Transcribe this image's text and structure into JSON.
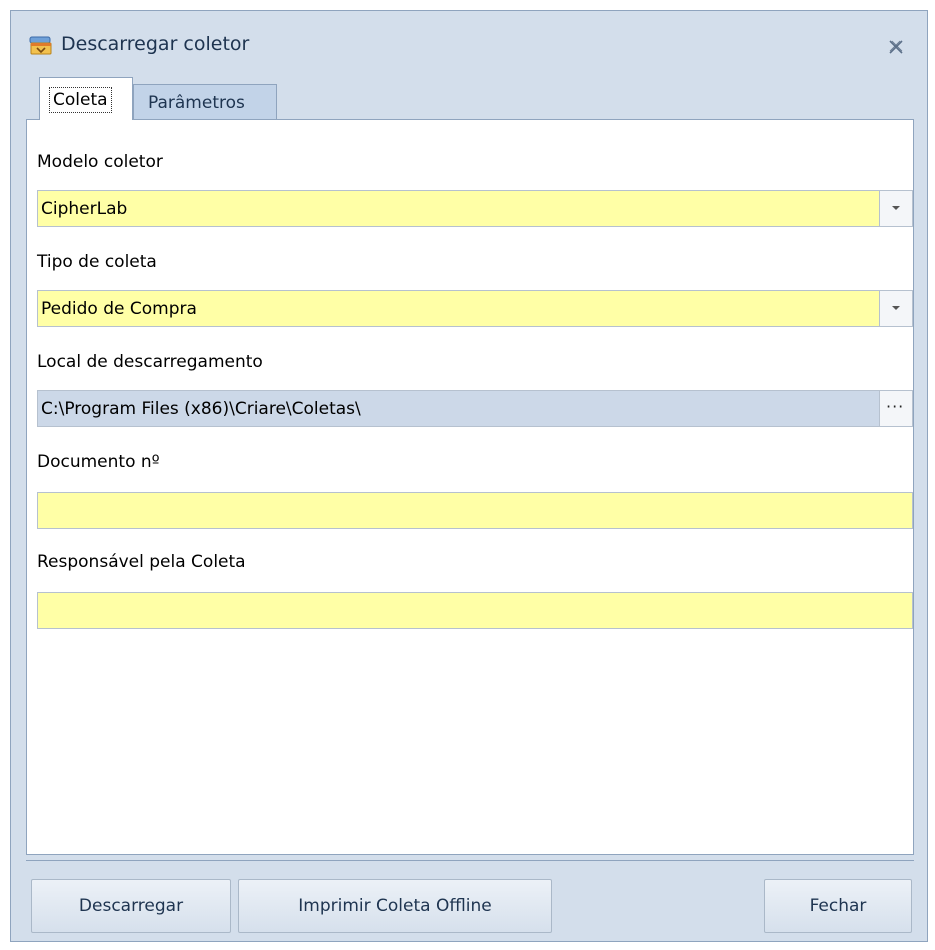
{
  "window": {
    "title": "Descarregar coletor",
    "icon": "download-collector-icon",
    "close_icon": "close-icon"
  },
  "tabs": [
    {
      "label": "Coleta",
      "active": true
    },
    {
      "label": "Parâmetros",
      "active": false
    }
  ],
  "form": {
    "modelo": {
      "label": "Modelo coletor",
      "value": "CipherLab"
    },
    "tipo": {
      "label": "Tipo de coleta",
      "value": "Pedido de Compra"
    },
    "local": {
      "label": "Local de descarregamento",
      "value": "C:\\Program Files (x86)\\Criare\\Coletas\\",
      "button": "···"
    },
    "documento": {
      "label": "Documento nº",
      "value": ""
    },
    "responsavel": {
      "label": "Responsável pela Coleta",
      "value": ""
    }
  },
  "buttons": {
    "descarregar": "Descarregar",
    "imprimir": "Imprimir Coleta Offline",
    "fechar": "Fechar"
  },
  "colors": {
    "input_highlight": "#ffffa6",
    "path_field": "#ccd8e8",
    "chrome": "#d3deeb"
  }
}
